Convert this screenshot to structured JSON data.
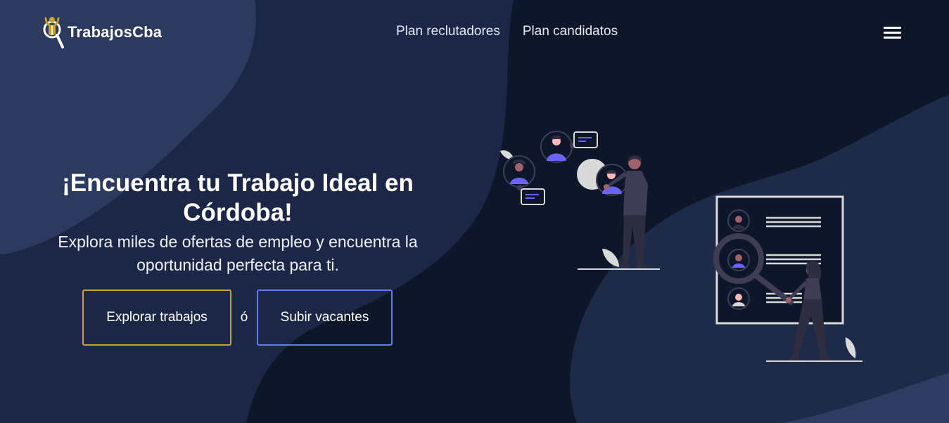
{
  "brand": {
    "name": "TrabajosCba",
    "logo_color": "#c9a22a"
  },
  "nav": {
    "links": [
      {
        "label": "Plan reclutadores"
      },
      {
        "label": "Plan candidatos"
      }
    ],
    "menu_icon": "hamburger-menu-icon"
  },
  "hero": {
    "title": "¡Encuentra tu Trabajo Ideal en Córdoba!",
    "subtitle": "Explora miles de ofertas de empleo y encuentra la oportunidad perfecta para ti."
  },
  "cta": {
    "primary_label": "Explorar trabajos",
    "separator": "ó",
    "secondary_label": "Subir vacantes",
    "primary_border_color": "#c9a22a",
    "secondary_border_color": "#5b7ef0"
  },
  "theme": {
    "background": "#0e1629",
    "shape_color": "#1d2a48",
    "accent_purple": "#6c63ff"
  }
}
